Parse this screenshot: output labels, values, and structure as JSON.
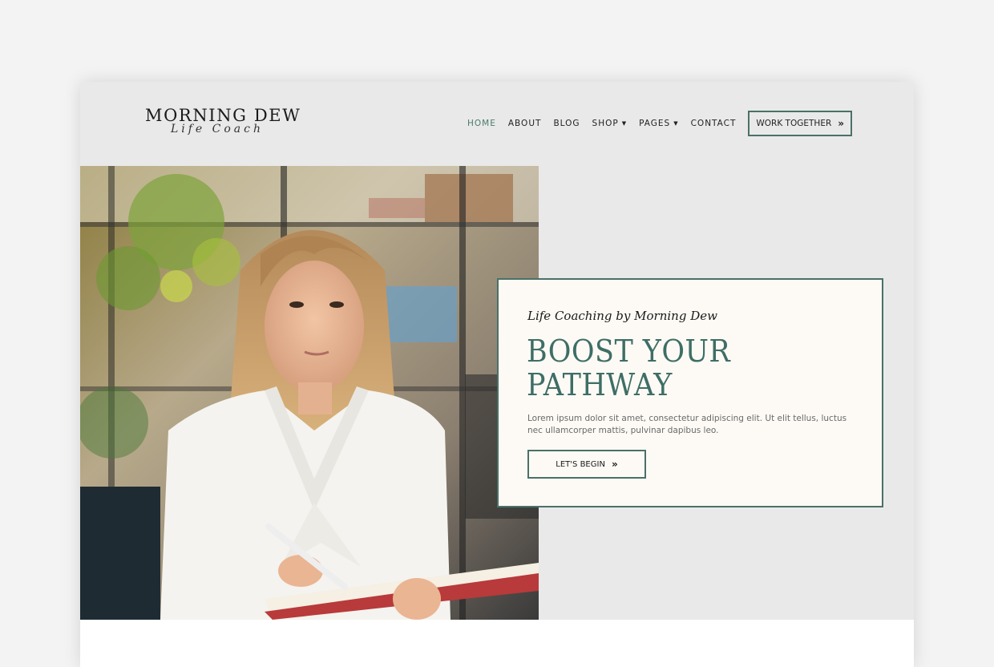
{
  "logo": {
    "main": "MORNING DEW",
    "sub": "Life Coach"
  },
  "nav": {
    "items": [
      {
        "label": "HOME",
        "active": true,
        "dropdown": false
      },
      {
        "label": "ABOUT",
        "active": false,
        "dropdown": false
      },
      {
        "label": "BLOG",
        "active": false,
        "dropdown": false
      },
      {
        "label": "SHOP",
        "active": false,
        "dropdown": true
      },
      {
        "label": "PAGES",
        "active": false,
        "dropdown": true
      },
      {
        "label": "CONTACT",
        "active": false,
        "dropdown": false
      }
    ],
    "cta_label": "WORK TOGETHER",
    "cta_icon": "double-chevron-right-icon"
  },
  "hero": {
    "image_alt": "Woman in white blouse holding a notebook and pen in a plant-filled office",
    "tagline": "Life Coaching by Morning Dew",
    "headline": "BOOST YOUR PATHWAY",
    "body": "Lorem ipsum dolor sit amet, consectetur adipiscing elit. Ut elit tellus, luctus nec ullamcorper mattis, pulvinar dapibus leo.",
    "button_label": "LET'S BEGIN",
    "button_icon": "double-chevron-right-icon"
  },
  "colors": {
    "accent": "#4a7168",
    "headline": "#3e6e66",
    "nav_active": "#4b7b70",
    "card_bg": "#fdfaf5",
    "page_bg": "#e9e9e9"
  }
}
